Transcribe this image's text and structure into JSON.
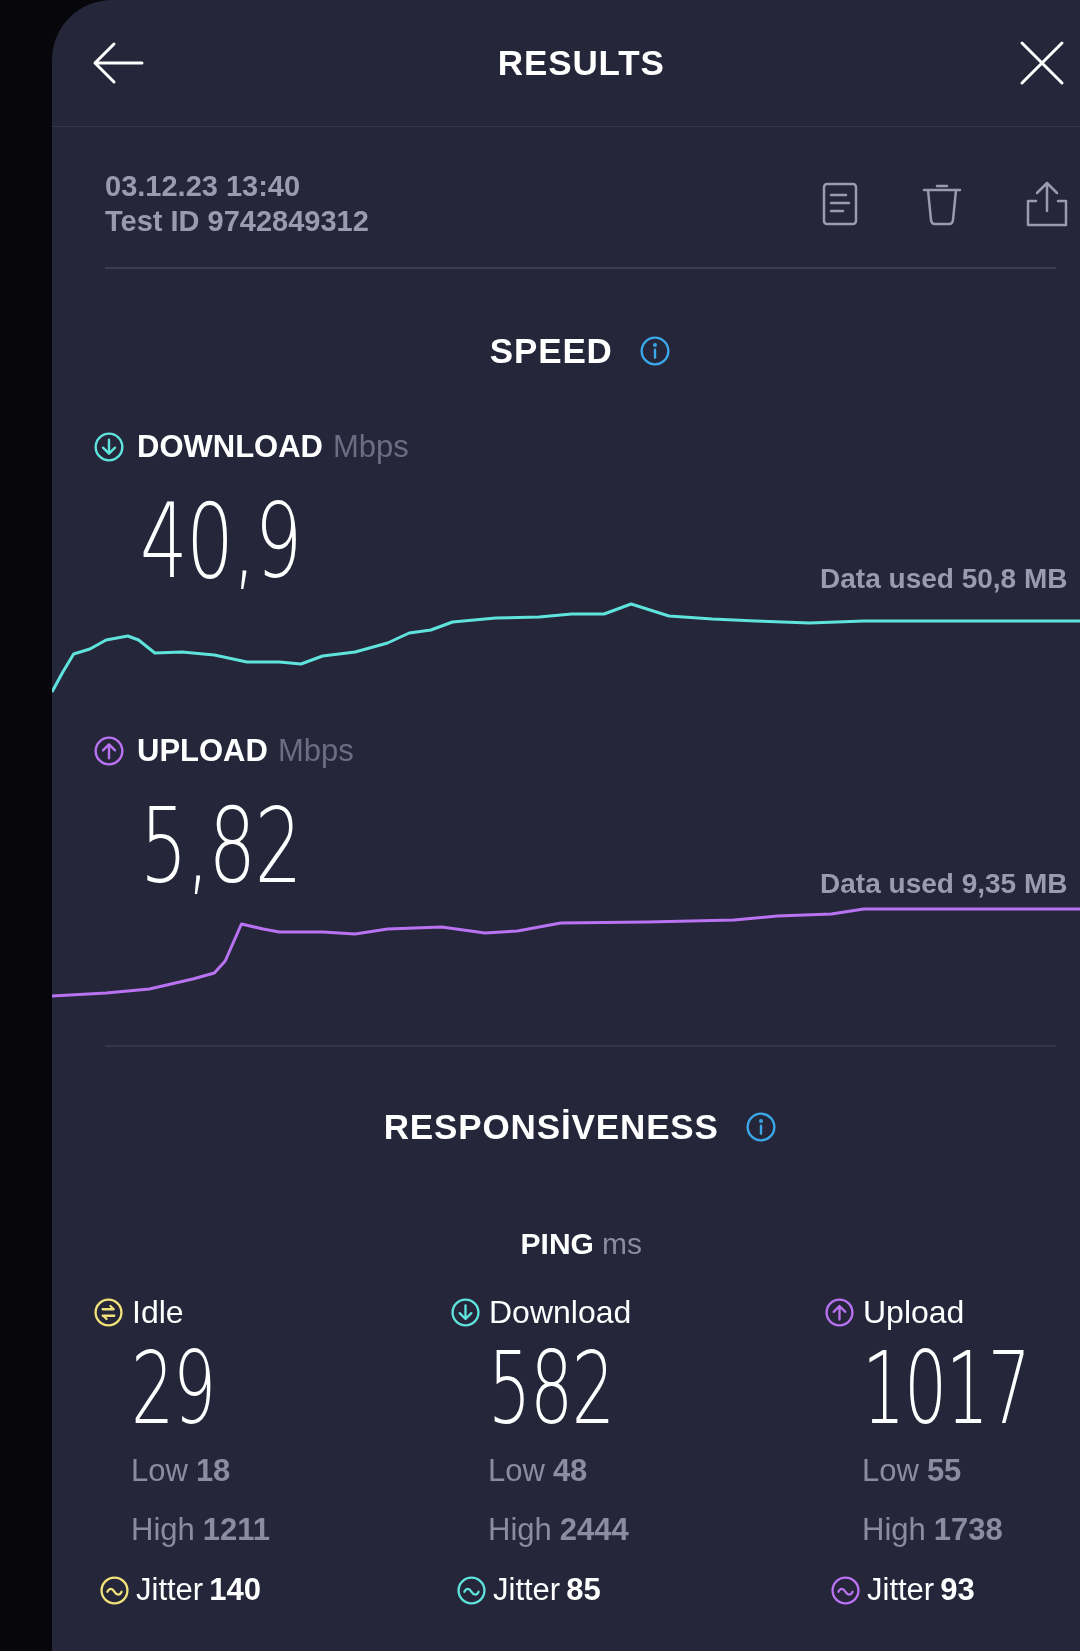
{
  "header": {
    "title": "RESULTS"
  },
  "test": {
    "date": "03.12.23 13:40",
    "id": "Test ID 9742849312"
  },
  "speed": {
    "title": "SPEED",
    "metrics": [
      {
        "kind": "download",
        "label": "DOWNLOAD",
        "unit": "Mbps",
        "value": "40,9",
        "data_used": "Data used 50,8 MB"
      },
      {
        "kind": "upload",
        "label": "UPLOAD",
        "unit": "Mbps",
        "value": "5,82",
        "data_used": "Data used 9,35 MB"
      }
    ]
  },
  "responsiveness": {
    "title": "RESPONSİVENESS",
    "ping_label": "PING",
    "ping_unit": "ms",
    "columns": [
      {
        "kind": "idle",
        "label": "Idle",
        "value": "29",
        "low_label": "Low",
        "low": "18",
        "high_label": "High",
        "high": "1211",
        "jitter_label": "Jitter",
        "jitter": "140"
      },
      {
        "kind": "download",
        "label": "Download",
        "value": "582",
        "low_label": "Low",
        "low": "48",
        "high_label": "High",
        "high": "2444",
        "jitter_label": "Jitter",
        "jitter": "85"
      },
      {
        "kind": "upload",
        "label": "Upload",
        "value": "1017",
        "low_label": "Low",
        "low": "55",
        "high_label": "High",
        "high": "1738",
        "jitter_label": "Jitter",
        "jitter": "93"
      }
    ]
  }
}
